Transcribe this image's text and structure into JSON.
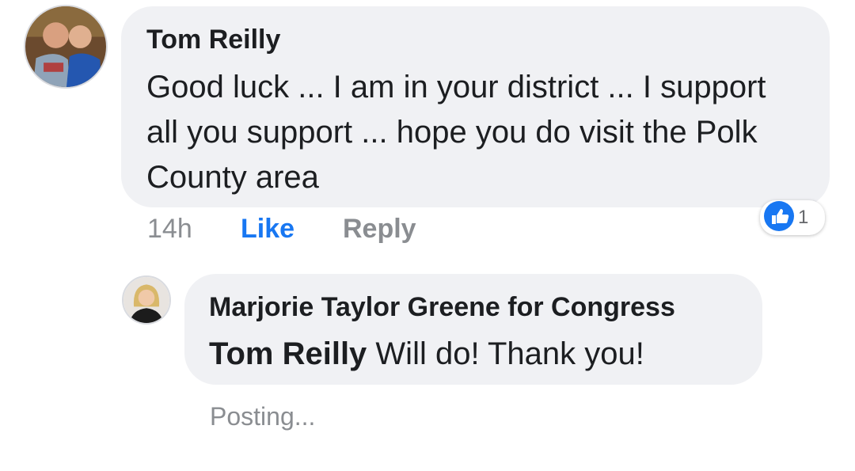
{
  "comment": {
    "author": "Tom Reilly",
    "text": "Good luck ... I am in your district ... I support all you support ... hope  you do visit the Polk County area",
    "time": "14h",
    "like_label": "Like",
    "reply_label": "Reply",
    "reaction": {
      "icon": "thumbs-up-icon",
      "count": "1"
    }
  },
  "reply": {
    "author": "Marjorie Taylor Greene for Congress",
    "mention": "Tom Reilly",
    "text": "Will do! Thank you!",
    "status": "Posting..."
  },
  "colors": {
    "bubble": "#f0f1f4",
    "accent": "#1877f2",
    "muted": "#8a8d91",
    "text": "#1c1e21"
  }
}
